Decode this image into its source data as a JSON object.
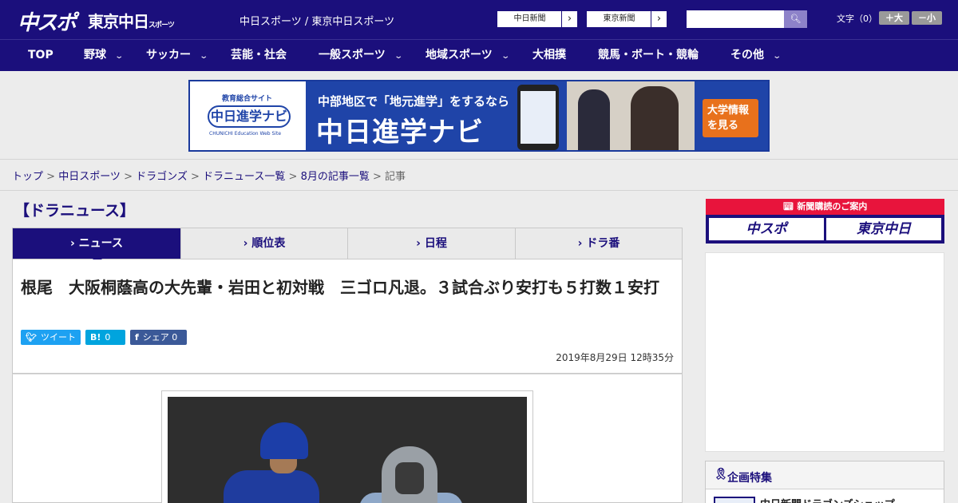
{
  "header": {
    "logo_main": "中スポ",
    "logo_tokyo": "東京中日",
    "logo_tokyo_suffix": "スポーツ",
    "site_links": "中日スポーツ / 東京中日スポーツ",
    "paper_buttons": [
      "中日新聞",
      "東京新聞"
    ],
    "search_placeholder": "",
    "search_icon": "search-icon",
    "font_size_label": "文字（0）",
    "font_larger": "＋大",
    "font_smaller": "－小"
  },
  "nav": {
    "items": [
      {
        "label": "TOP",
        "has_dropdown": false
      },
      {
        "label": "野球",
        "has_dropdown": true
      },
      {
        "label": "サッカー",
        "has_dropdown": true
      },
      {
        "label": "芸能・社会",
        "has_dropdown": false
      },
      {
        "label": "一般スポーツ",
        "has_dropdown": true
      },
      {
        "label": "地域スポーツ",
        "has_dropdown": true
      },
      {
        "label": "大相撲",
        "has_dropdown": false
      },
      {
        "label": "競馬・ボート・競輪",
        "has_dropdown": false
      },
      {
        "label": "その他",
        "has_dropdown": true
      }
    ],
    "chevron": "⌄"
  },
  "banner": {
    "logo_small": "教育総合サイト",
    "logo_main": "中日進学ナビ",
    "logo_sub": "CHUNICHI Education Web Site",
    "tagline": "中部地区で「地元進学」をするなら",
    "title": "中日進学ナビ",
    "cta": "大学情報を見る"
  },
  "breadcrumb": {
    "items": [
      "トップ",
      "中日スポーツ",
      "ドラゴンズ",
      "ドラニュース一覧",
      "8月の記事一覧"
    ],
    "separator": " > ",
    "current": "記事"
  },
  "section": {
    "title": "【ドラニュース】"
  },
  "tabs": [
    {
      "label": "ニュース",
      "active": true
    },
    {
      "label": "順位表",
      "active": false
    },
    {
      "label": "日程",
      "active": false
    },
    {
      "label": "ドラ番",
      "active": false
    }
  ],
  "tab_marker": "›",
  "article": {
    "headline": "根尾　大阪桐蔭高の大先輩・岩田と初対戦　三ゴロ凡退。３試合ぶり安打も５打数１安打",
    "published": "2019年8月29日 12時35分",
    "share": {
      "tweet": "ツイート",
      "hatena_icon": "B!",
      "hatena_count": "0",
      "facebook": "シェア",
      "facebook_count": "0"
    }
  },
  "sidebar": {
    "subscription_head": "新聞購読のご案内",
    "subscription_buttons": [
      "中スポ",
      "東京中日"
    ],
    "feature_title": "企画特集",
    "feature_item": "中日新聞ドラゴンズショップ"
  },
  "colors": {
    "brand_navy": "#1b0f7c",
    "twitter": "#1da1f2",
    "hatena": "#00a4de",
    "facebook": "#3b5998",
    "subscription_red": "#e8143c"
  }
}
